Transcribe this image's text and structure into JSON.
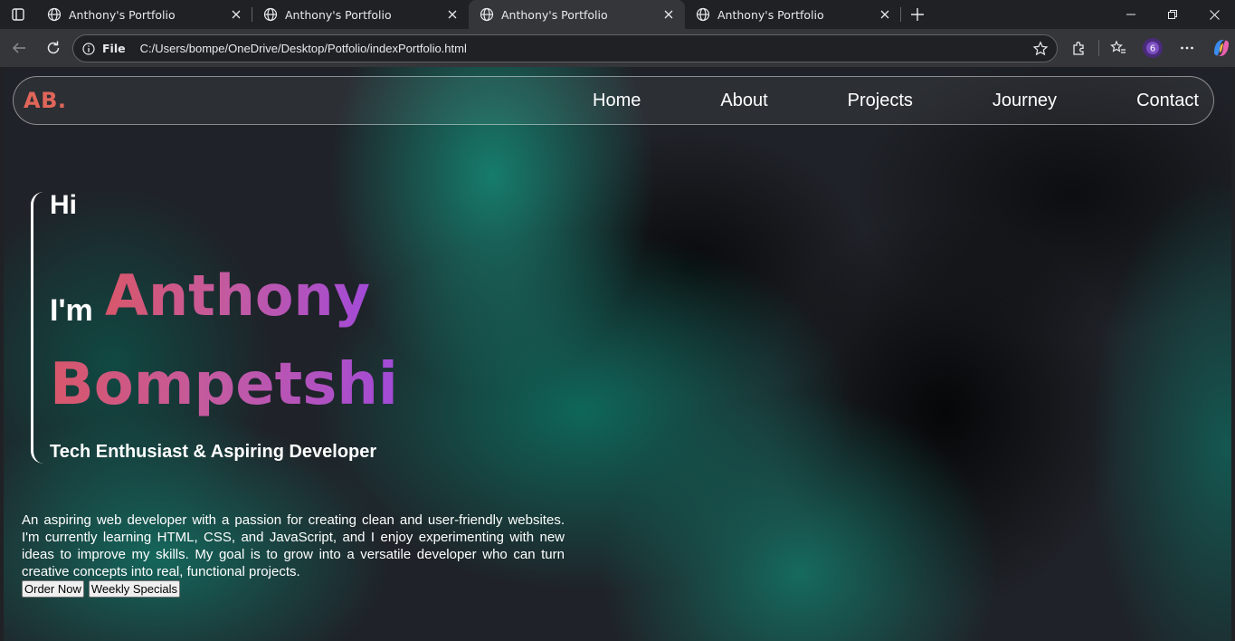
{
  "browser": {
    "tabs": [
      {
        "title": "Anthony's Portfolio",
        "active": false
      },
      {
        "title": "Anthony's Portfolio",
        "active": false
      },
      {
        "title": "Anthony's Portfolio",
        "active": true
      },
      {
        "title": "Anthony's Portfolio",
        "active": false
      }
    ],
    "address": {
      "scheme_label": "File",
      "url": "C:/Users/bompe/OneDrive/Desktop/Potfolio/indexPortfolio.html"
    },
    "profile_badge": "6",
    "colors": {
      "chrome_bg": "#202124",
      "toolbar_bg": "#35363a",
      "text": "#e8eaed"
    }
  },
  "page": {
    "logo": "AB.",
    "nav": [
      "Home",
      "About",
      "Projects",
      "Journey",
      "Contact"
    ],
    "hero": {
      "greeting": "Hi",
      "im": "I'm",
      "first_name": "Anthony",
      "last_name": "Bompetshi",
      "tagline": "Tech Enthusiast & Aspiring Developer"
    },
    "about": "An aspiring web developer with a passion for creating clean and user-friendly websites. I'm currently learning HTML, CSS, and JavaScript, and I enjoy experimenting with new ideas to improve my skills. My goal is to grow into a versatile developer who can turn creative concepts into real, functional projects.",
    "buttons": {
      "order": "Order Now",
      "specials": "Weekly Specials"
    },
    "colors": {
      "logo": "#e0665a",
      "gradient_start": "#d8576a",
      "gradient_end": "#a24ad8",
      "teal": "#148c78"
    }
  }
}
